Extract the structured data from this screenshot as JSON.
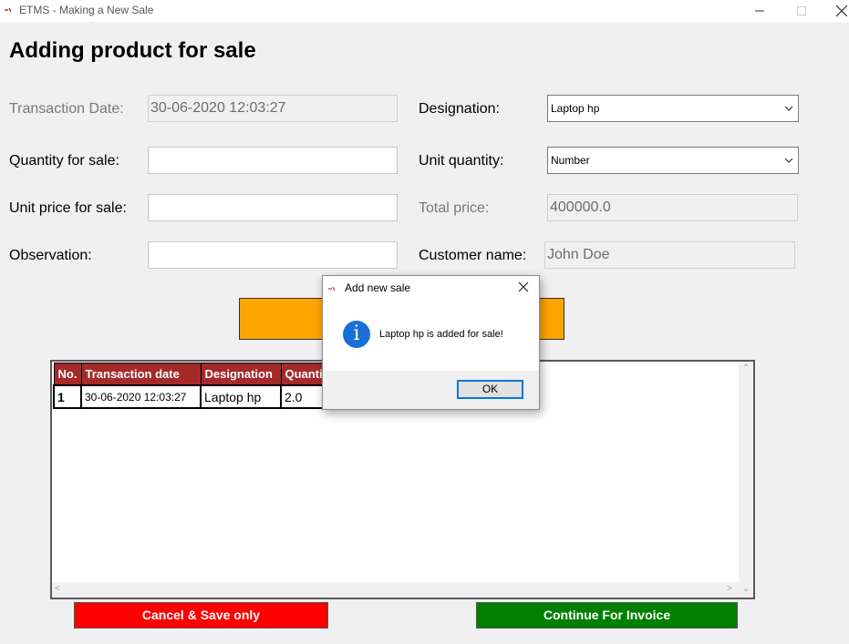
{
  "window": {
    "title": "ETMS - Making a New Sale"
  },
  "page": {
    "heading": "Adding product for sale"
  },
  "form": {
    "transaction_date_label": "Transaction Date:",
    "transaction_date_value": "30-06-2020  12:03:27",
    "quantity_label": "Quantity for sale:",
    "quantity_value": "",
    "unit_price_label": "Unit price for sale:",
    "unit_price_value": "",
    "observation_label": "Observation:",
    "observation_value": "",
    "designation_label": "Designation:",
    "designation_value": "Laptop hp",
    "unit_quantity_label": "Unit quantity:",
    "unit_quantity_value": "Number",
    "total_price_label": "Total  price:",
    "total_price_value": "400000.0",
    "customer_label": "Customer name:",
    "customer_value": "John Doe"
  },
  "table": {
    "columns": [
      "No.",
      "Transaction date",
      "Designation",
      "Quantit"
    ],
    "rows": [
      [
        "1",
        "30-06-2020  12:03:27",
        "Laptop hp",
        "2.0"
      ]
    ]
  },
  "buttons": {
    "cancel_save": "Cancel & Save only",
    "continue_invoice": "Continue For Invoice"
  },
  "dialog": {
    "title": "Add new sale",
    "message": "Laptop hp is added for sale!",
    "ok": "OK"
  },
  "colors": {
    "header": "#a52a2a",
    "add_button": "#ffa500",
    "cancel_button": "#ff0000",
    "continue_button": "#008000",
    "info_icon": "#1a6fd6"
  }
}
